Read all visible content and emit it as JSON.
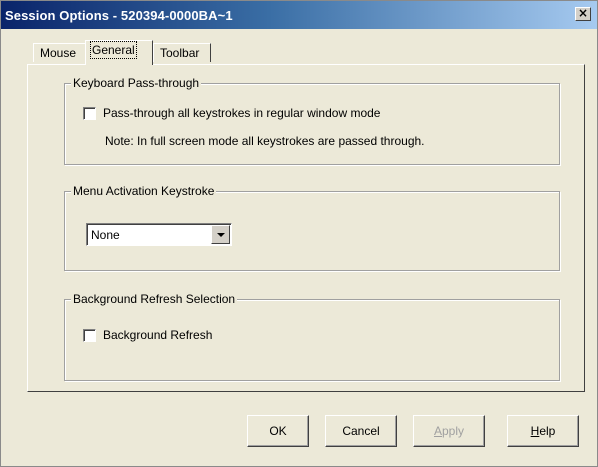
{
  "window": {
    "title": "Session Options - 520394-0000BA~1",
    "close_glyph": "×"
  },
  "tabs": [
    {
      "label": "Mouse"
    },
    {
      "label": "General"
    },
    {
      "label": "Toolbar"
    }
  ],
  "sections": {
    "keyboard": {
      "title": "Keyboard Pass-through",
      "checkbox_label": "Pass-through all keystrokes in regular window mode",
      "note": "Note: In full screen mode all keystrokes are passed through."
    },
    "menu": {
      "title": "Menu Activation Keystroke",
      "selected": "None"
    },
    "background": {
      "title": "Background Refresh Selection",
      "checkbox_label": "Background Refresh"
    }
  },
  "buttons": {
    "ok": "OK",
    "cancel": "Cancel",
    "apply": "Apply",
    "help": "Help"
  },
  "icons": {
    "close": "close-icon",
    "dropdown": "chevron-down-icon"
  },
  "colors": {
    "title_start": "#0a246a",
    "title_end": "#a6caf0",
    "window_bg": "#ece9d8"
  }
}
